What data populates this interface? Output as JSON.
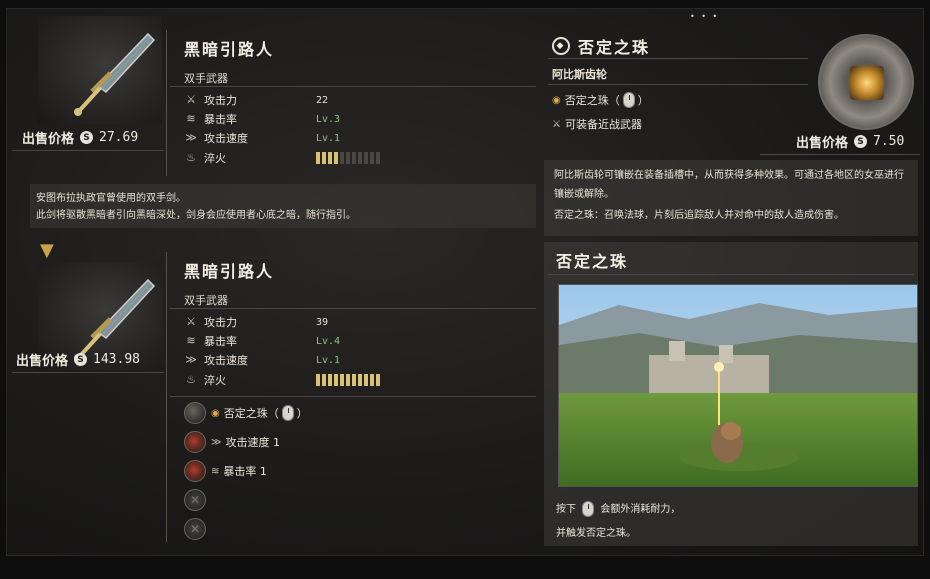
{
  "top_item": {
    "name": "黑暗引路人",
    "type": "双手武器",
    "price_label": "出售价格",
    "price": "27.69",
    "stats": [
      {
        "label": "攻击力",
        "value": "22",
        "style": "plain"
      },
      {
        "label": "暴击率",
        "value": "Lv.3",
        "style": "green"
      },
      {
        "label": "攻击速度",
        "value": "Lv.1",
        "style": "green"
      },
      {
        "label": "淬火",
        "bars_on": 4,
        "bars_total": 11
      }
    ],
    "description": [
      "安图布拉执政官曾使用的双手剑。",
      "此剑将驱散黑暗者引向黑暗深处，剑身会应使用者心底之暗，随行指引。"
    ]
  },
  "bottom_item": {
    "name": "黑暗引路人",
    "type": "双手武器",
    "price_label": "出售价格",
    "price": "143.98",
    "stats": [
      {
        "label": "攻击力",
        "value": "39",
        "style": "plain"
      },
      {
        "label": "暴击率",
        "value": "Lv.4",
        "style": "green"
      },
      {
        "label": "攻击速度",
        "value": "Lv.1",
        "style": "green"
      },
      {
        "label": "淬火",
        "bars_on": 11,
        "bars_total": 11
      }
    ],
    "slots": [
      {
        "label": "否定之珠",
        "kind": "orb",
        "open": "（",
        "close": "）"
      },
      {
        "label": "攻击速度 1",
        "kind": "red"
      },
      {
        "label": "暴击率 1",
        "kind": "red"
      },
      {
        "label": "",
        "kind": "empty"
      },
      {
        "label": "",
        "kind": "empty"
      }
    ]
  },
  "gem": {
    "title": "否定之珠",
    "subtitle": "阿比斯齿轮",
    "skill_label": "否定之珠",
    "skill_open": "（",
    "skill_close": "）",
    "equip_note": "可装备近战武器",
    "price_label": "出售价格",
    "price": "7.50",
    "description_1": "阿比斯齿轮可镶嵌在装备插槽中，从而获得多种效果。可通过各地区的女巫进行镶嵌或解除。",
    "description_2": "否定之珠：召唤法球，片刻后追踪敌人并对命中的敌人造成伤害。",
    "preview_title": "否定之珠",
    "footer_pre": "按下",
    "footer_post": "会额外消耗耐力，",
    "footer_line2": "并触发否定之珠。"
  },
  "colors": {
    "accent_gold": "#c9a24a",
    "stat_green": "#8ec28a",
    "bar_on": "#d8c27a"
  }
}
